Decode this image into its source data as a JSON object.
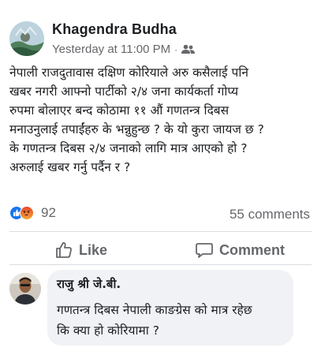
{
  "header_fragment": "",
  "post": {
    "author": "Khagendra Budha",
    "timestamp": "Yesterday at 11:00 PM",
    "separator": "·",
    "audience_icon": "friends-icon",
    "lines": [
      "नेपाली राजदुतावास दक्षिण कोरियाले अरु कसैलाई पनि",
      "खबर नगरी आफ्नो पार्टीको २/४ जना कार्यकर्ता गोप्य",
      "रुपमा बोलाएर बन्द कोठामा ११ औं गणतन्त्र दिबस",
      "मनाउनुलाई तपाईंहरु के भन्नुहुन्छ ? के यो कुरा जायज छ ?",
      "के गणतन्त्र दिबस २/४ जनाको लागि मात्र आएको हो ?",
      "अरुलाई खबर गर्नु पर्दैन र ?"
    ]
  },
  "reactions": {
    "count": "92",
    "types": [
      "like-icon",
      "angry-icon"
    ],
    "colors": {
      "like": "#1877f2",
      "angry": "#e9472b"
    }
  },
  "comments_count": "55 comments",
  "actions": {
    "like_label": "Like",
    "comment_label": "Comment"
  },
  "comment": {
    "author": "राजु श्री जे.बी.",
    "lines": [
      "गणतन्त्र दिबस नेपाली काङग्रेस को मात्र रहेछ",
      "कि क्या हो कोरियामा ?"
    ]
  }
}
